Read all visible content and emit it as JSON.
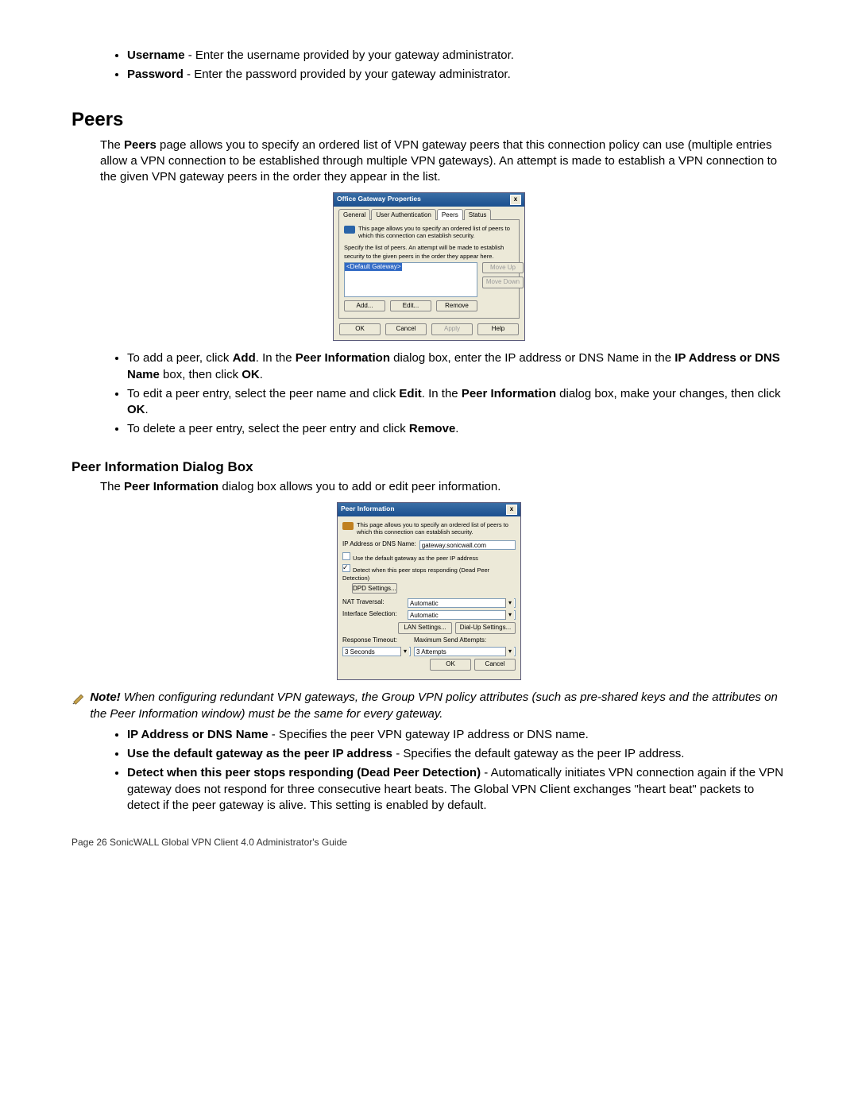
{
  "intro_list": {
    "username_label": "Username",
    "username_desc": " - Enter the username provided by your gateway administrator.",
    "password_label": "Password",
    "password_desc": " - Enter the password provided by your gateway administrator."
  },
  "peers_heading": "Peers",
  "peers_intro_a": "The ",
  "peers_intro_b": "Peers",
  "peers_intro_c": " page allows you to specify an ordered list of VPN gateway peers that this connection policy can use (multiple entries allow a VPN connection to be established through multiple VPN gateways). An attempt is made to establish a VPN connection to the given VPN gateway peers in the order they appear in the list.",
  "dlg1": {
    "title": "Office Gateway Properties",
    "tabs": [
      "General",
      "User Authentication",
      "Peers",
      "Status"
    ],
    "hint": "This page allows you to specify an ordered list of peers to which this connection can establish security.",
    "spec": "Specify the list of peers. An attempt will be made to establish security to the given peers in the order they appear here.",
    "list_item": "<Default Gateway>",
    "side": {
      "moveup": "Move Up",
      "movedown": "Move Down"
    },
    "row": {
      "add": "Add...",
      "edit": "Edit...",
      "remove": "Remove"
    },
    "bottom": {
      "ok": "OK",
      "cancel": "Cancel",
      "apply": "Apply",
      "help": "Help"
    }
  },
  "peers_bullets": {
    "b1a": "To add a peer, click ",
    "b1b": "Add",
    "b1c": ". In the ",
    "b1d": "Peer Information",
    "b1e": " dialog box, enter the IP address or DNS Name in the ",
    "b1f": "IP Address or DNS Name",
    "b1g": " box, then click ",
    "b1h": "OK",
    "b1i": ".",
    "b2a": "To edit a peer entry, select the peer name and click ",
    "b2b": "Edit",
    "b2c": ". In the ",
    "b2d": "Peer Information",
    "b2e": " dialog box, make your changes, then click ",
    "b2f": "OK",
    "b2g": ".",
    "b3a": "To delete a peer entry, select the peer entry and click ",
    "b3b": "Remove",
    "b3c": "."
  },
  "pi_heading": "Peer Information Dialog Box",
  "pi_intro_a": "The ",
  "pi_intro_b": "Peer Information",
  "pi_intro_c": " dialog box allows you to add or edit peer information.",
  "dlg2": {
    "title": "Peer Information",
    "hint": "This page allows you to specify an ordered list of peers to which this connection can establish security.",
    "ip_label": "IP Address or DNS Name:",
    "ip_value": "gateway.sonicwall.com",
    "use_default": "Use the default gateway as the peer IP address",
    "dpd_label": "Detect when this peer stops responding (Dead Peer Detection)",
    "dpd_btn": "DPD Settings...",
    "nat_lbl": "NAT Traversal:",
    "nat_val": "Automatic",
    "iface_lbl": "Interface Selection:",
    "iface_val": "Automatic",
    "lan_btn": "LAN Settings...",
    "dial_btn": "Dial-Up Settings...",
    "resp_lbl": "Response Timeout:",
    "resp_val": "3 Seconds",
    "max_lbl": "Maximum Send Attempts:",
    "max_val": "3 Attempts",
    "ok": "OK",
    "cancel": "Cancel"
  },
  "note": {
    "label": "Note!",
    "text": " When configuring redundant VPN gateways, the Group VPN policy attributes (such as pre-shared keys and the attributes on the Peer Information window) must be the same for every gateway."
  },
  "defs": {
    "ip_l": "IP Address or DNS Name",
    "ip_d": " - Specifies the peer VPN gateway IP address or DNS name.",
    "ud_l": "Use the default gateway as the peer IP address",
    "ud_d": " - Specifies the default gateway as the peer IP address.",
    "dpd_l": "Detect when this peer stops responding (Dead Peer Detection)",
    "dpd_d": " - Automatically initiates VPN connection again if the VPN gateway does not respond for three consecutive heart beats. The Global VPN Client exchanges \"heart beat\" packets to detect if the peer gateway is alive. This setting is enabled by default."
  },
  "footer": "Page 26 SonicWALL Global VPN Client 4.0 Administrator's Guide"
}
